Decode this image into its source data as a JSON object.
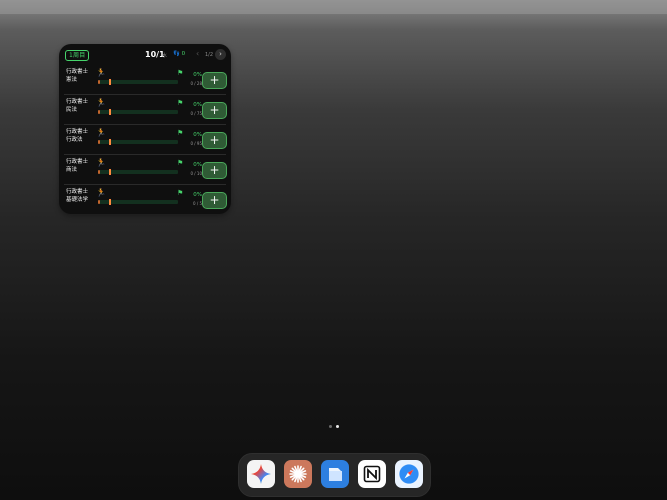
{
  "widget": {
    "week_badge": "1周目",
    "date": "10/1",
    "weekday": "水",
    "streak": "👣 0",
    "prev_symbol": "‹",
    "page_indicator": "1/2",
    "next_symbol": "›",
    "rows": [
      {
        "line1": "行政書士",
        "line2": "憲法",
        "percent": "0%",
        "progress": 0,
        "count": "0 / 28"
      },
      {
        "line1": "行政書士",
        "line2": "民法",
        "percent": "0%",
        "progress": 0,
        "count": "0 / 75"
      },
      {
        "line1": "行政書士",
        "line2": "行政法",
        "percent": "0%",
        "progress": 0,
        "count": "0 / 95"
      },
      {
        "line1": "行政書士",
        "line2": "商法",
        "percent": "0%",
        "progress": 0,
        "count": "0 / 10"
      },
      {
        "line1": "行政書士",
        "line2": "基礎法学",
        "percent": "0%",
        "progress": 0,
        "count": "0 / 5"
      }
    ],
    "add_label": "+"
  },
  "page_dots": {
    "count": 2,
    "active_index": 1
  },
  "dock": {
    "apps": [
      {
        "name": "gemini-app-icon"
      },
      {
        "name": "claude-app-icon"
      },
      {
        "name": "files-app-icon"
      },
      {
        "name": "notion-app-icon"
      },
      {
        "name": "safari-app-icon"
      }
    ]
  },
  "colors": {
    "accent_green": "#46d36b",
    "progress_orange": "#c4652d",
    "button_green": "#2f5b35"
  }
}
